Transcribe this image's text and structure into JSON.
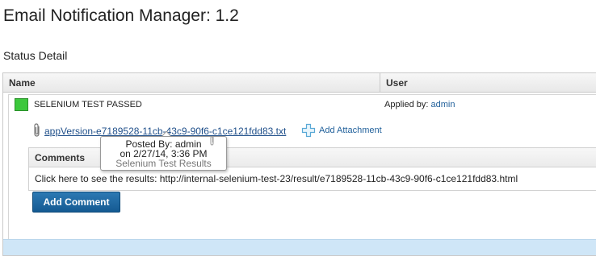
{
  "page": {
    "title": "Email Notification Manager: 1.2",
    "section_title": "Status Detail"
  },
  "table": {
    "columns": [
      "Name",
      "User"
    ],
    "row": {
      "status_color": "#3cc83c",
      "status_text": "SELENIUM TEST PASSED",
      "applied_by_label": "Applied by:",
      "applied_by_user": "admin",
      "attachment": {
        "icon": "paperclip-icon",
        "file_name": "appVersion-e7189528-11cb-43c9-90f6-c1ce121fdd83.txt",
        "add_icon": "plus-icon",
        "add_label": "Add Attachment"
      },
      "comments": {
        "title": "Comments",
        "items": [
          "Click here to see the results: http://internal-selenium-test-23/result/e7189528-11cb-43c9-90f6-c1ce121fdd83.html"
        ]
      },
      "add_comment_label": "Add Comment"
    }
  },
  "tooltip": {
    "posted_by": "Posted By: admin",
    "posted_on": "on 2/27/14, 3:36 PM",
    "subject": "Selenium Test Results"
  },
  "colors": {
    "accent_button": "#1a68a4",
    "link": "#1f4f8a",
    "footer_band": "#cfe6f7"
  }
}
